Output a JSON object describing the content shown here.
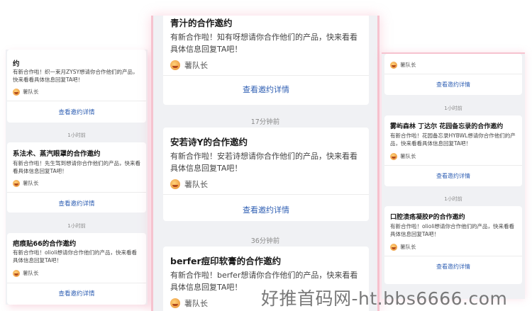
{
  "left": {
    "cards": [
      {
        "title": "约",
        "desc": "有新合作啦！织一束月ZYSY想请你合作他们的产品，快来看看具体信息回复TA吧！",
        "sender": "薯队长",
        "link": "查看邀约详情"
      },
      {
        "title": "系法术、蒸汽眼罩的合作邀约",
        "desc": "有新合作啦！先生驾到想请你合作他们的产品，快来看看具体信息回复TA吧！",
        "sender": "薯队长",
        "link": "查看邀约详情"
      },
      {
        "title": "疤痕贴66的合作邀约",
        "desc": "有新合作啦！olioli想请你合作他们的产品，快来看看具体信息回复TA吧！",
        "sender": "薯队长",
        "link": "查看邀约详情"
      }
    ],
    "times": [
      "1小时前",
      "1小时前"
    ]
  },
  "center": {
    "cards": [
      {
        "title": "青汁的合作邀约",
        "desc": "有新合作啦！知有呀想请你合作他们的产品，快来看看具体信息回复TA吧！",
        "sender": "薯队长",
        "link": "查看邀约详情"
      },
      {
        "title": "安若诗Y的合作邀约",
        "desc": "有新合作啦！安若诗想请你合作他们的产品，快来看看具体信息回复TA吧！",
        "sender": "薯队长",
        "link": "查看邀约详情"
      },
      {
        "title": "berfer痘印软膏的合作邀约",
        "desc": "有新合作啦！berfer想请你合作他们的产品，快来看看具体信息回复TA吧！",
        "sender": "薯队长"
      }
    ],
    "times": [
      "17分钟前",
      "36分钟前"
    ]
  },
  "right": {
    "cards": [
      {
        "sender": "薯队长",
        "link": "查看邀约详情"
      },
      {
        "title": "雾屿森林 丁达尔 花园备忘录的合作邀约",
        "desc": "有新合作啦！花园备忘录HYBWL想请你合作他们的产品，快来看看具体信息回复TA吧！",
        "sender": "薯队长",
        "link": "查看邀约详情"
      },
      {
        "title": "口腔溃疡凝胶P的合作邀约",
        "desc": "有新合作啦！olioli想请你合作他们的产品，快来看看具体信息回复TA吧！",
        "sender": "薯队长",
        "link": "查看邀约详情"
      }
    ],
    "times": [
      "1小时前",
      "1小时前"
    ]
  },
  "watermark": "好推首码网-ht.bbs6666.com"
}
